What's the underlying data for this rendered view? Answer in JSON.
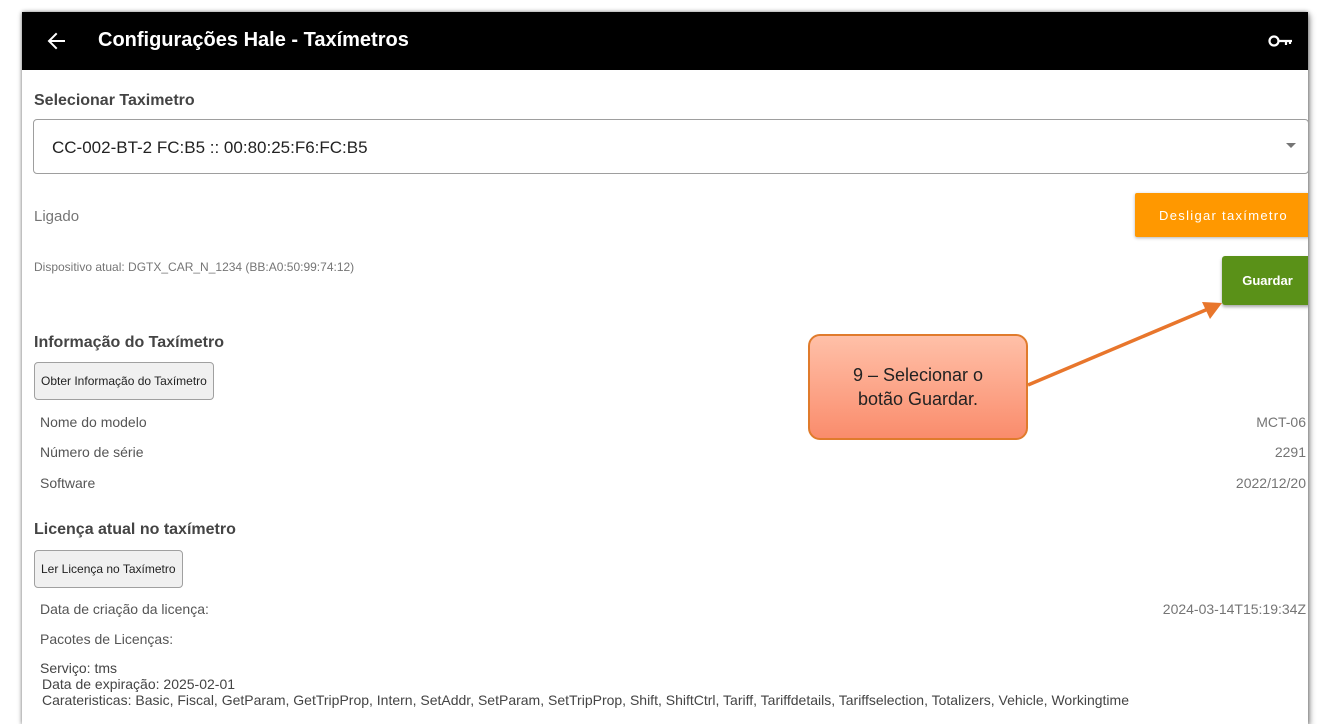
{
  "app_bar": {
    "title": "Configurações Hale - Taxímetros",
    "back_icon": "arrow-left-icon",
    "key_icon": "key-icon"
  },
  "select_taximeter": {
    "label": "Selecionar Taximetro",
    "value": "CC-002-BT-2 FC:B5 :: 00:80:25:F6:FC:B5"
  },
  "connection": {
    "status": "Ligado",
    "disconnect_label": "Desligar taxímetro",
    "device_text": "Dispositivo atual: DGTX_CAR_N_1234 (BB:A0:50:99:74:12)",
    "save_label": "Guardar"
  },
  "taximeter_info": {
    "heading": "Informação do Taxímetro",
    "button_label": "Obter Informação do Taxímetro",
    "rows": [
      {
        "label": "Nome do modelo",
        "value": "MCT-06"
      },
      {
        "label": "Número de série",
        "value": "2291"
      },
      {
        "label": "Software",
        "value": "2022/12/20"
      }
    ]
  },
  "license": {
    "heading": "Licença atual no taxímetro",
    "button_label": "Ler Licença no Taxímetro",
    "creation_label": "Data de criação da licença:",
    "creation_value": "2024-03-14T15:19:34Z",
    "packages_label": "Pacotes de Licenças:",
    "service": "Serviço: tms",
    "expiration": "Data de expiração: 2025-02-01",
    "features": "Carateristicas: Basic, Fiscal, GetParam, GetTripProp, Intern, SetAddr, SetParam, SetTripProp, Shift, ShiftCtrl, Tariff, Tariffdetails, Tariffselection, Totalizers, Vehicle, Workingtime"
  },
  "callout": {
    "line1": "9 – Selecionar o",
    "line2": "botão Guardar."
  },
  "colors": {
    "orange_button": "#ff9800",
    "green_button": "#5a9118",
    "callout_fill": "#fa8c6c",
    "arrow": "#e8762c"
  }
}
